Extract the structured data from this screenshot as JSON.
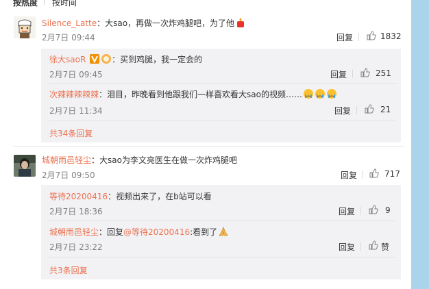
{
  "sort": {
    "hot": "按热度",
    "time": "按时间"
  },
  "comments": [
    {
      "user": "Silence_Latte",
      "text": "：大sao，再做一次炸鸡腿吧，为了他",
      "time": "2月7日 09:44",
      "reply": "回复",
      "likes": "1832",
      "replies": [
        {
          "user": "徐大saoR",
          "text": "：买到鸡腿，我一定会的",
          "time": "2月7日 09:45",
          "reply": "回复",
          "likes": "251"
        },
        {
          "user": "次辣辣辣辣辣",
          "text": "：泪目，昨晚看到他跟我们一样喜欢看大sao的视频……",
          "time": "2月7日 11:34",
          "reply": "回复",
          "likes": "21"
        }
      ],
      "more": "共34条回复"
    },
    {
      "user": "城朝雨邑轻尘",
      "text": "：大sao为李文亮医生在做一次炸鸡腿吧",
      "time": "2月7日 09:50",
      "reply": "回复",
      "likes": "717",
      "replies": [
        {
          "user": "等待20200416",
          "text": "：视频出来了，在b站可以看",
          "time": "2月7日 18:36",
          "reply": "回复",
          "likes": "9"
        },
        {
          "user": "城朝雨邑轻尘",
          "text": "：回复",
          "mention": "@等待20200416",
          "text2": ":看到了",
          "time": "2月7日 23:22",
          "reply": "回复",
          "likes": "赞"
        }
      ],
      "more": "共3条回复"
    }
  ],
  "colors": {
    "accent": "#eb7350",
    "sidebar": "#a9d4ec",
    "sub_bg": "#f2f2f5"
  },
  "icons": {
    "like": "thumb-up-icon",
    "verified": "v-badge-icon",
    "fan": "fan-badge-icon",
    "emoji_candle": "candle-emoji-icon",
    "emoji_cry": "crying-emoji-icon",
    "emoji_pray": "pray-emoji-icon"
  }
}
